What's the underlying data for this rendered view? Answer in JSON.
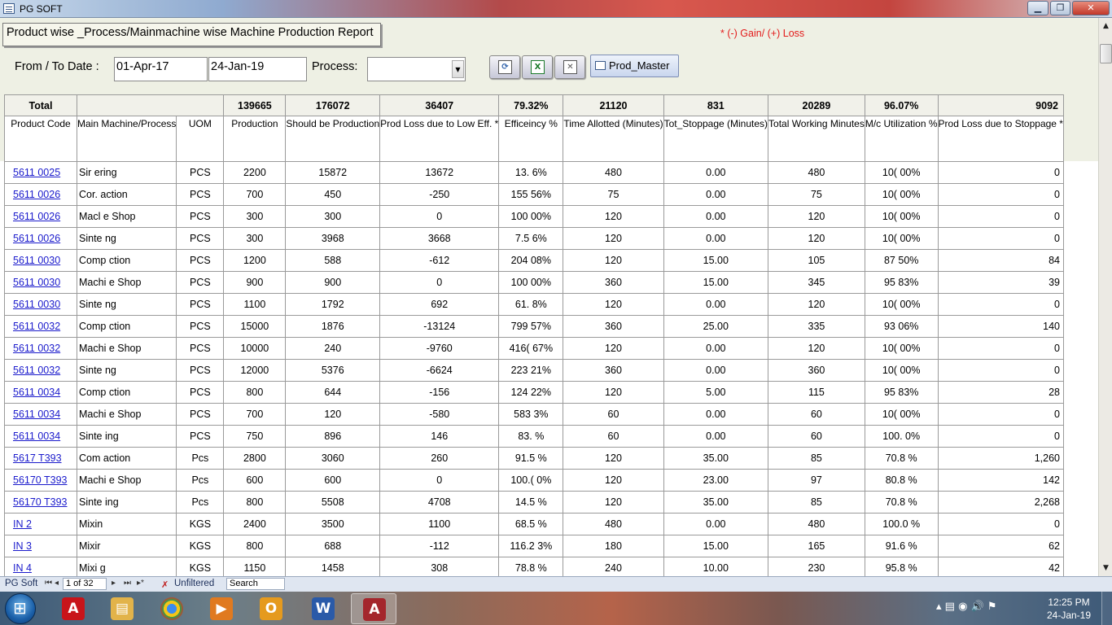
{
  "window": {
    "title": "PG SOFT",
    "min": "▁",
    "max": "❐",
    "close": "✕"
  },
  "header": {
    "report_title": "Product wise _Process/Mainmachine wise Machine Production Report",
    "gain_loss_note": "* (-) Gain/ (+) Loss",
    "from_to_label": "From / To Date :",
    "from_date": "01-Apr-17",
    "to_date": "24-Jan-19",
    "process_label": "Process:",
    "process_value": "",
    "prod_master_label": "Prod_Master"
  },
  "totals": {
    "label": "Total",
    "production": "139665",
    "should_be": "176072",
    "prod_loss_eff": "36407",
    "efficiency": "79.32%",
    "time_allotted": "21120",
    "tot_stoppage": "831",
    "working_minutes": "20289",
    "utilization": "96.07%",
    "prod_loss_stoppage": "9092"
  },
  "columns": {
    "product_code": "Product Code",
    "main_machine": "Main Machine/Process",
    "uom": "UOM",
    "production": "Production",
    "should_be": "Should be Production",
    "prod_loss_eff": "Prod Loss due to Low Eff. *",
    "efficiency": "Efficeincy %",
    "time_allotted": "Time Allotted (Minutes)",
    "tot_stoppage": "Tot_Stoppage (Minutes)",
    "working_minutes": "Total Working Minutes",
    "utilization": "M/c Utilization %",
    "prod_loss_stoppage": "Prod Loss due to Stoppage *"
  },
  "rows": [
    {
      "code": "5611  0025",
      "process": "Sir  ering",
      "uom": "PCS",
      "production": "2200",
      "should_be": "15872",
      "loss_eff": "13672",
      "eff": "13.  6%",
      "time": "480",
      "stoppage": "0.00",
      "working": "480",
      "util": "10(  00%",
      "loss_stop": "0"
    },
    {
      "code": "5611  0026",
      "process": "Cor.  action",
      "uom": "PCS",
      "production": "700",
      "should_be": "450",
      "loss_eff": "-250",
      "eff": "155  56%",
      "time": "75",
      "stoppage": "0.00",
      "working": "75",
      "util": "10(  00%",
      "loss_stop": "0"
    },
    {
      "code": "5611  0026",
      "process": "Macl  e Shop",
      "uom": "PCS",
      "production": "300",
      "should_be": "300",
      "loss_eff": "0",
      "eff": "100  00%",
      "time": "120",
      "stoppage": "0.00",
      "working": "120",
      "util": "10(  00%",
      "loss_stop": "0"
    },
    {
      "code": "5611  0026",
      "process": "Sinte  ng",
      "uom": "PCS",
      "production": "300",
      "should_be": "3968",
      "loss_eff": "3668",
      "eff": "7.5  6%",
      "time": "120",
      "stoppage": "0.00",
      "working": "120",
      "util": "10(  00%",
      "loss_stop": "0"
    },
    {
      "code": "5611  0030",
      "process": "Comp  ction",
      "uom": "PCS",
      "production": "1200",
      "should_be": "588",
      "loss_eff": "-612",
      "eff": "204  08%",
      "time": "120",
      "stoppage": "15.00",
      "working": "105",
      "util": "87  50%",
      "loss_stop": "84"
    },
    {
      "code": "5611  0030",
      "process": "Machi  e Shop",
      "uom": "PCS",
      "production": "900",
      "should_be": "900",
      "loss_eff": "0",
      "eff": "100  00%",
      "time": "360",
      "stoppage": "15.00",
      "working": "345",
      "util": "95  83%",
      "loss_stop": "39"
    },
    {
      "code": "5611  0030",
      "process": "Sinte  ng",
      "uom": "PCS",
      "production": "1100",
      "should_be": "1792",
      "loss_eff": "692",
      "eff": "61.  8%",
      "time": "120",
      "stoppage": "0.00",
      "working": "120",
      "util": "10(  00%",
      "loss_stop": "0"
    },
    {
      "code": "5611  0032",
      "process": "Comp  ction",
      "uom": "PCS",
      "production": "15000",
      "should_be": "1876",
      "loss_eff": "-13124",
      "eff": "799  57%",
      "time": "360",
      "stoppage": "25.00",
      "working": "335",
      "util": "93  06%",
      "loss_stop": "140"
    },
    {
      "code": "5611  0032",
      "process": "Machi  e Shop",
      "uom": "PCS",
      "production": "10000",
      "should_be": "240",
      "loss_eff": "-9760",
      "eff": "416(  67%",
      "time": "120",
      "stoppage": "0.00",
      "working": "120",
      "util": "10(  00%",
      "loss_stop": "0"
    },
    {
      "code": "5611  0032",
      "process": "Sinte  ng",
      "uom": "PCS",
      "production": "12000",
      "should_be": "5376",
      "loss_eff": "-6624",
      "eff": "223  21%",
      "time": "360",
      "stoppage": "0.00",
      "working": "360",
      "util": "10(  00%",
      "loss_stop": "0"
    },
    {
      "code": "5611  0034",
      "process": "Comp  ction",
      "uom": "PCS",
      "production": "800",
      "should_be": "644",
      "loss_eff": "-156",
      "eff": "124  22%",
      "time": "120",
      "stoppage": "5.00",
      "working": "115",
      "util": "95  83%",
      "loss_stop": "28"
    },
    {
      "code": "5611  0034",
      "process": "Machi  e Shop",
      "uom": "PCS",
      "production": "700",
      "should_be": "120",
      "loss_eff": "-580",
      "eff": "583  3%",
      "time": "60",
      "stoppage": "0.00",
      "working": "60",
      "util": "10(  00%",
      "loss_stop": "0"
    },
    {
      "code": "5611  0034",
      "process": "Sinte  ing",
      "uom": "PCS",
      "production": "750",
      "should_be": "896",
      "loss_eff": "146",
      "eff": "83.  %",
      "time": "60",
      "stoppage": "0.00",
      "working": "60",
      "util": "100.  0%",
      "loss_stop": "0"
    },
    {
      "code": "5617  T393",
      "process": "Com  action",
      "uom": "Pcs",
      "production": "2800",
      "should_be": "3060",
      "loss_eff": "260",
      "eff": "91.5  %",
      "time": "120",
      "stoppage": "35.00",
      "working": "85",
      "util": "70.8  %",
      "loss_stop": "1,260"
    },
    {
      "code": "56170  T393",
      "process": "Machi  e Shop",
      "uom": "Pcs",
      "production": "600",
      "should_be": "600",
      "loss_eff": "0",
      "eff": "100.(  0%",
      "time": "120",
      "stoppage": "23.00",
      "working": "97",
      "util": "80.8  %",
      "loss_stop": "142"
    },
    {
      "code": "56170  T393",
      "process": "Sinte  ing",
      "uom": "Pcs",
      "production": "800",
      "should_be": "5508",
      "loss_eff": "4708",
      "eff": "14.5  %",
      "time": "120",
      "stoppage": "35.00",
      "working": "85",
      "util": "70.8  %",
      "loss_stop": "2,268"
    },
    {
      "code": "IN  2",
      "process": "Mixin",
      "uom": "KGS",
      "production": "2400",
      "should_be": "3500",
      "loss_eff": "1100",
      "eff": "68.5  %",
      "time": "480",
      "stoppage": "0.00",
      "working": "480",
      "util": "100.0  %",
      "loss_stop": "0"
    },
    {
      "code": "IN  3",
      "process": "Mixir",
      "uom": "KGS",
      "production": "800",
      "should_be": "688",
      "loss_eff": "-112",
      "eff": "116.2  3%",
      "time": "180",
      "stoppage": "15.00",
      "working": "165",
      "util": "91.6  %",
      "loss_stop": "62"
    },
    {
      "code": "IN  4",
      "process": "Mixi  g",
      "uom": "KGS",
      "production": "1150",
      "should_be": "1458",
      "loss_eff": "308",
      "eff": "78.8  %",
      "time": "240",
      "stoppage": "10.00",
      "working": "230",
      "util": "95.8  %",
      "loss_stop": "42"
    }
  ],
  "statusbar": {
    "app": "PG Soft",
    "record": "1 of 32",
    "filter": "Unfiltered",
    "search": "Search"
  },
  "taskbar": {
    "time": "12:25 PM",
    "date": "24-Jan-19"
  }
}
